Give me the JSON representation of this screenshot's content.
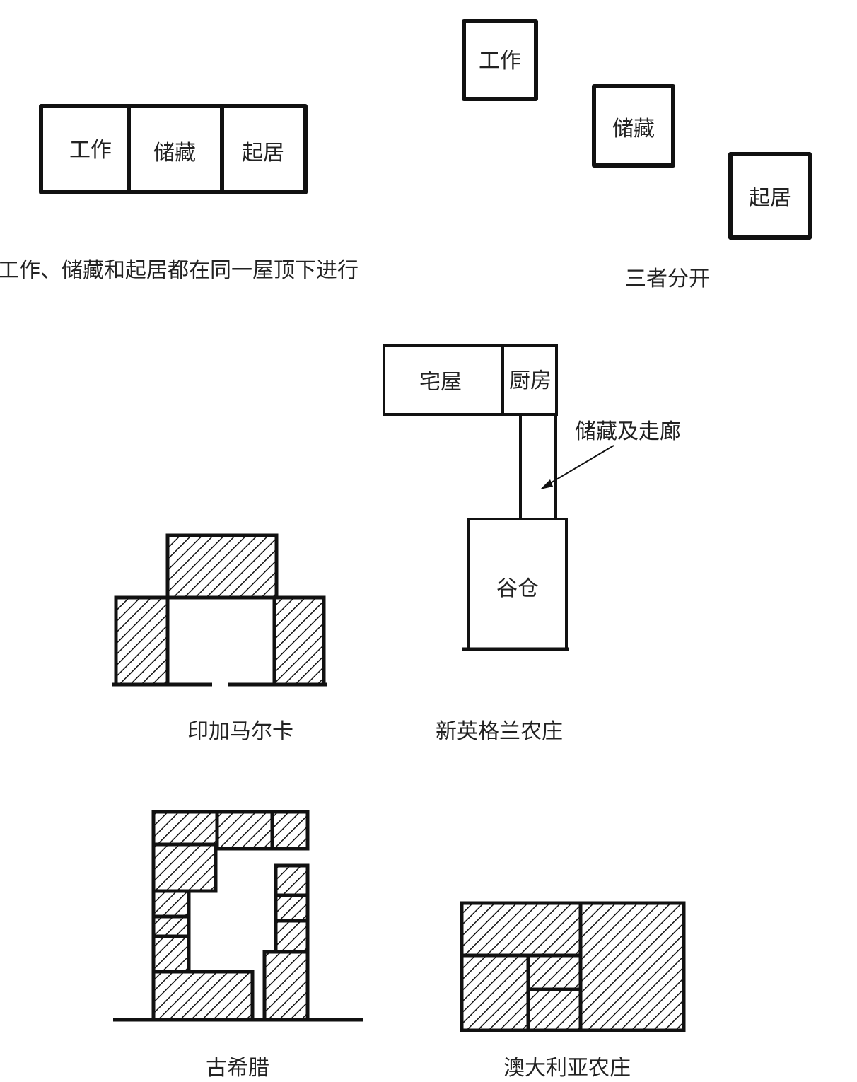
{
  "combined": {
    "rooms": [
      "工作",
      "储藏",
      "起居"
    ],
    "caption": "工作、储藏和起居都在同一屋顶下进行"
  },
  "separated": {
    "rooms": [
      "工作",
      "储藏",
      "起居"
    ],
    "caption": "三者分开"
  },
  "new_england": {
    "house": "宅屋",
    "kitchen": "厨房",
    "corridor": "储藏及走廊",
    "barn": "谷仓",
    "caption": "新英格兰农庄"
  },
  "inca": {
    "caption": "印加马尔卡"
  },
  "greece": {
    "caption": "古希腊"
  },
  "australia": {
    "caption": "澳大利亚农庄"
  }
}
